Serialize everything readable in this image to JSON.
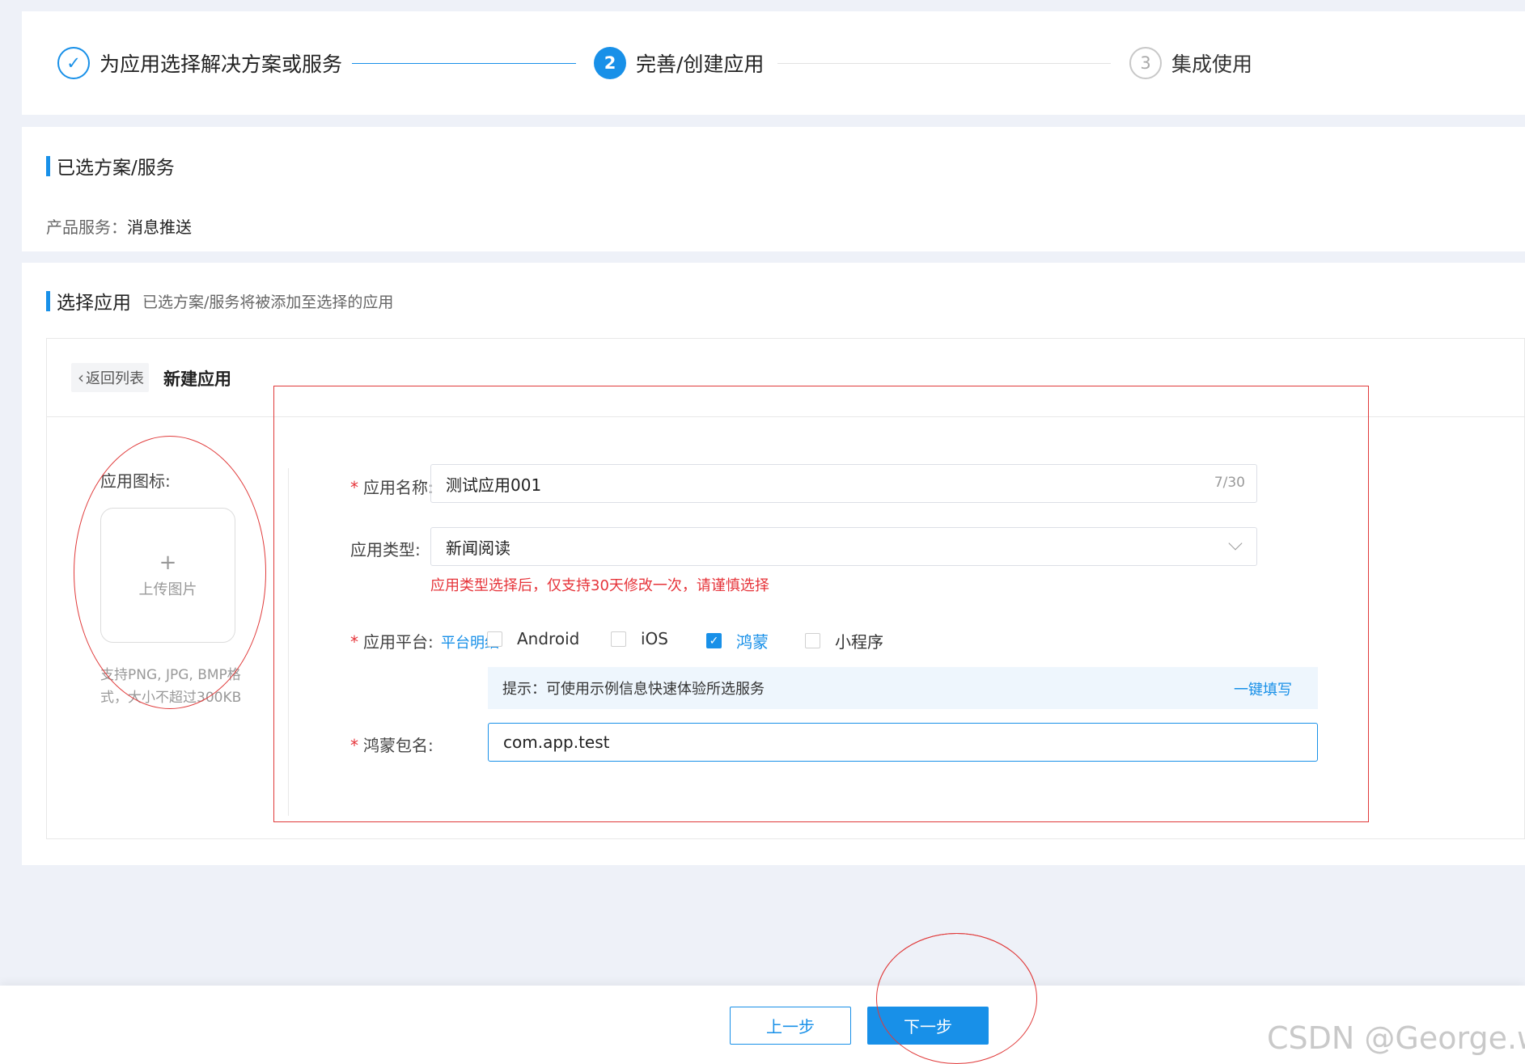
{
  "steps": [
    {
      "label": "为应用选择解决方案或服务",
      "state": "done",
      "marker": "✓"
    },
    {
      "label": "完善/创建应用",
      "state": "active",
      "number": "2"
    },
    {
      "label": "集成使用",
      "state": "pending",
      "number": "3"
    }
  ],
  "selected": {
    "title": "已选方案/服务",
    "service_label": "产品服务：",
    "service_value": "消息推送"
  },
  "choose": {
    "title": "选择应用",
    "note": "已选方案/服务将被添加至选择的应用",
    "back_label": "返回列表",
    "new_title": "新建应用",
    "icon_label": "应用图标:",
    "upload_plus": "+",
    "upload_text": "上传图片",
    "upload_hint": "支持PNG, JPG, BMP格式，大小不超过300KB",
    "required_mark": "*",
    "name_label": "应用名称:",
    "name_value": "测试应用001",
    "name_count": "7/30",
    "type_label": "应用类型:",
    "type_value": "新闻阅读",
    "type_warning": "应用类型选择后，仅支持30天修改一次，请谨慎选择",
    "platform_label": "应用平台:",
    "platform_detail_link": "平台明细",
    "platforms": [
      {
        "label": "Android",
        "checked": false
      },
      {
        "label": "iOS",
        "checked": false
      },
      {
        "label": "鸿蒙",
        "checked": true
      },
      {
        "label": "小程序",
        "checked": false
      }
    ],
    "check_mark": "✓",
    "tip_text": "提示：可使用示例信息快速体验所选服务",
    "tip_link": "一键填写",
    "pkg_label": "鸿蒙包名:",
    "pkg_value": "com.app.test"
  },
  "footer": {
    "prev_label": "上一步",
    "next_label": "下一步"
  },
  "watermark": "CSDN @George.wu.",
  "colors": {
    "primary": "#1890e8",
    "danger": "#e6343a",
    "annotation": "#e03a3a",
    "page_bg": "#eef1f8"
  }
}
